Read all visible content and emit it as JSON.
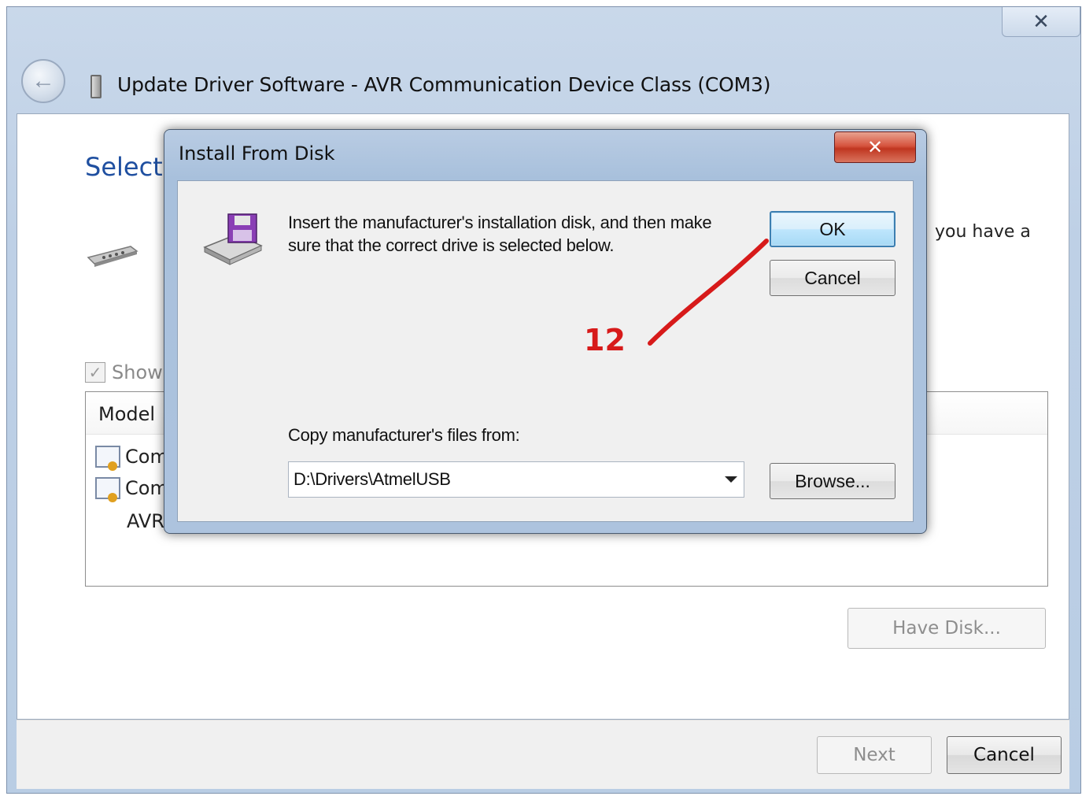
{
  "wizard": {
    "title": "Update Driver Software - AVR Communication Device Class (COM3)",
    "close_glyph": "✕",
    "back_glyph": "←",
    "heading_partial": "Select t",
    "description_partial": "you have a",
    "show_compatible_partial": "Show",
    "model_list": {
      "header": "Model",
      "items": [
        "Com",
        "Com",
        "AVR"
      ]
    },
    "have_disk_label": "Have Disk...",
    "next_label": "Next",
    "cancel_label": "Cancel"
  },
  "dialog": {
    "title": "Install From Disk",
    "close_glyph": "✕",
    "message": "Insert the manufacturer's installation disk, and then make sure that the correct drive is selected below.",
    "ok_label": "OK",
    "cancel_label": "Cancel",
    "copy_label": "Copy manufacturer's files from:",
    "path_value": "D:\\Drivers\\AtmelUSB",
    "browse_label": "Browse..."
  },
  "annotation": {
    "step_number": "12",
    "color": "#d71a1a"
  },
  "colors": {
    "heading_blue": "#1f4fa0",
    "ok_focus_border": "#3c7fb1",
    "close_red": "#c03620"
  },
  "icons": [
    "back-arrow-icon",
    "usb-device-icon",
    "serial-port-icon",
    "checkbox-icon",
    "certificate-icon",
    "floppy-disk-icon",
    "dropdown-arrow-icon",
    "close-icon"
  ]
}
